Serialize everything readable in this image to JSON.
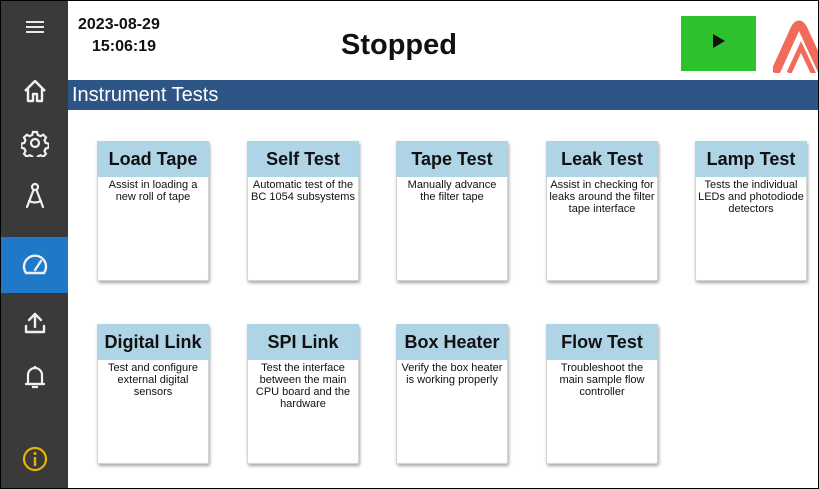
{
  "header": {
    "date": "2023-08-29",
    "time": "15:06:19",
    "status": "Stopped"
  },
  "sidebar": {
    "items": [
      {
        "name": "menu-icon",
        "active": false
      },
      {
        "name": "home-icon",
        "active": false
      },
      {
        "name": "gear-icon",
        "active": false
      },
      {
        "name": "compass-icon",
        "active": false
      },
      {
        "name": "gauge-icon",
        "active": true
      },
      {
        "name": "upload-icon",
        "active": false
      },
      {
        "name": "bell-icon",
        "active": false
      },
      {
        "name": "info-icon",
        "active": false
      }
    ]
  },
  "section": {
    "title": "Instrument Tests"
  },
  "tests": [
    {
      "title": "Load Tape",
      "desc": "Assist in loading a new roll of tape"
    },
    {
      "title": "Self Test",
      "desc": "Automatic test of the BC 1054 subsystems"
    },
    {
      "title": "Tape Test",
      "desc": "Manually advance the filter tape"
    },
    {
      "title": "Leak Test",
      "desc": "Assist in checking for leaks around the filter tape interface"
    },
    {
      "title": "Lamp Test",
      "desc": "Tests the individual LEDs and photodiode detectors"
    },
    {
      "title": "Digital Link",
      "desc": "Test and configure external digital sensors"
    },
    {
      "title": "SPI Link",
      "desc": "Test the interface between the main CPU board and the hardware"
    },
    {
      "title": "Box Heater",
      "desc": "Verify the box heater is working properly"
    },
    {
      "title": "Flow Test",
      "desc": "Troubleshoot the main sample flow controller"
    }
  ],
  "colors": {
    "sidebar": "#3a3a3a",
    "sidebar_active": "#1f78c8",
    "section_bar": "#2d5585",
    "card_header": "#aed4e6",
    "play_button": "#2ec12e",
    "logo": "#f26a5a"
  }
}
